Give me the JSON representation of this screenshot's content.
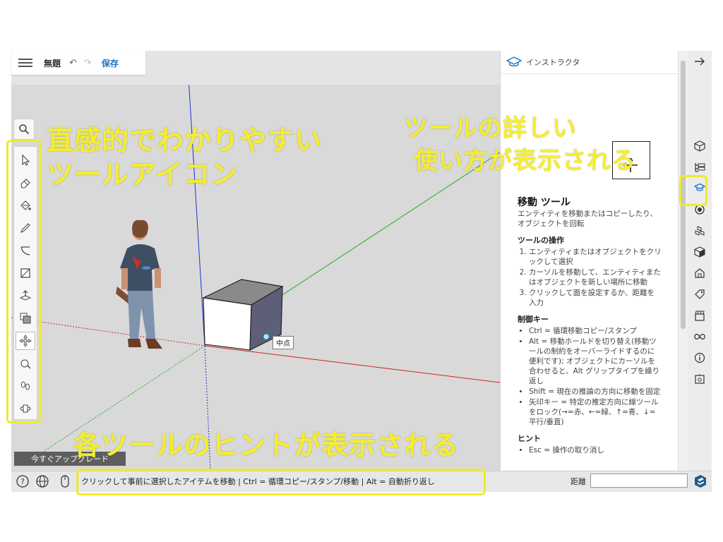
{
  "app": {
    "file_name": "無題",
    "save_label": "保存"
  },
  "toolbar": {
    "tools": [
      {
        "name": "select-icon"
      },
      {
        "name": "eraser-icon"
      },
      {
        "name": "paint-bucket-icon"
      },
      {
        "name": "pencil-line-icon"
      },
      {
        "name": "arc-icon"
      },
      {
        "name": "rectangle-icon"
      },
      {
        "name": "push-pull-icon"
      },
      {
        "name": "offset-icon"
      },
      {
        "name": "move-icon",
        "active": true
      },
      {
        "name": "tape-measure-icon"
      },
      {
        "name": "footprints-icon"
      },
      {
        "name": "orbit-icon"
      }
    ]
  },
  "instructor": {
    "panel_title": "インストラクタ",
    "tool_title": "移動 ツール",
    "tool_desc": "エンティティを移動またはコピーしたり、オブジェクトを回転",
    "ops_heading": "ツールの操作",
    "ops": [
      "エンティティまたはオブジェクトをクリックして選択",
      "カーソルを移動して、エンティティまたはオブジェクトを新しい場所に移動",
      "クリックして面を設定するか、距離を入力"
    ],
    "keys_heading": "制御キー",
    "keys": [
      "Ctrl = 循環移動コピー/スタンプ",
      "Alt = 移動ホールドを切り替え(移動ツールの制約をオーバーライドするのに便利です); オブジェクトにカーソルを合わせると、Alt グリップタイプを繰り返し",
      "Shift = 現在の推論の方向に移動を固定",
      "矢印キー = 特定の推定方向に線ツールをロック(→=赤、←=緑、↑=青、↓=平行/垂直)"
    ],
    "hint_heading": "ヒント",
    "hint_first": "Esc = 操作の取り消し"
  },
  "viewport": {
    "inference_label": "中点",
    "upgrade_label": "今すぐアップグレード"
  },
  "status": {
    "hint_text": "クリックして事前に選択したアイテムを移動 | Ctrl = 循環コピー/スタンプ/移動 | Alt = 自動折り返し",
    "distance_label": "距離",
    "distance_value": ""
  },
  "callouts": {
    "left_1": "直感的でわかりやすい",
    "left_2": "ツールアイコン",
    "right_1": "ツールの詳しい",
    "right_2": "使い方が表示される",
    "bottom": "各ツールのヒントが表示される"
  },
  "colors": {
    "callout": "#f5ee2b",
    "accent": "#1a73c8",
    "axis_red": "#cc2222",
    "axis_green": "#22aa22",
    "axis_blue": "#2233cc"
  }
}
